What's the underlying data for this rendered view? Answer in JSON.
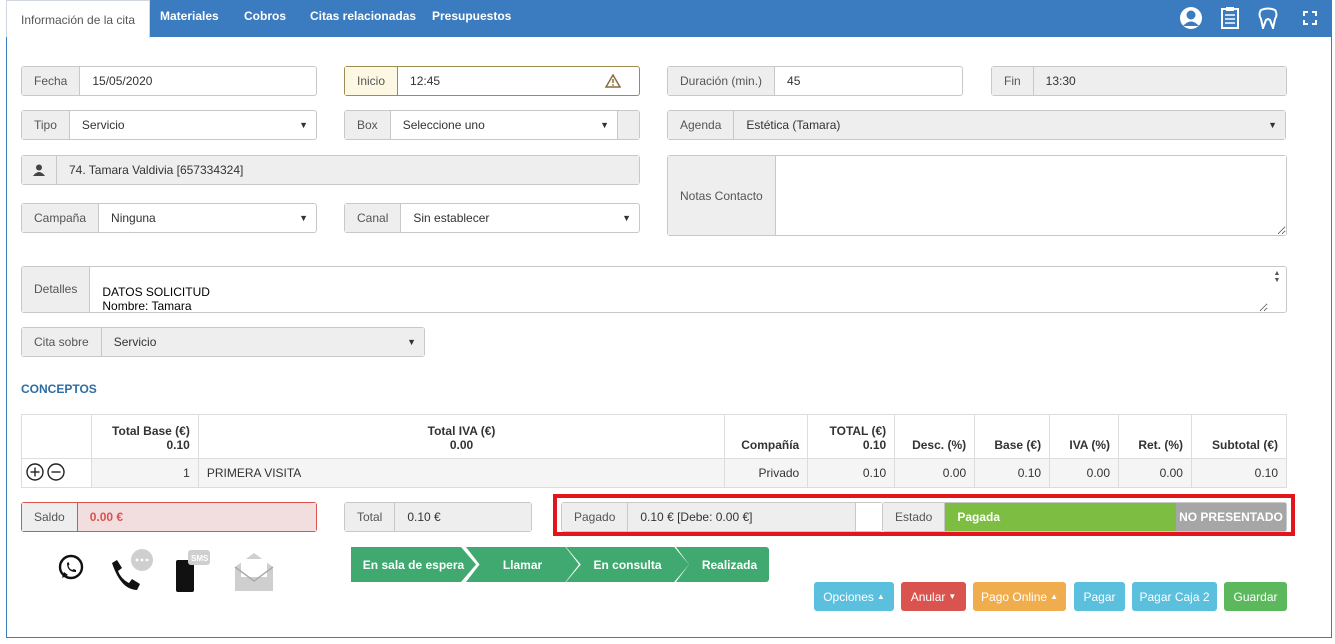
{
  "tabs": [
    {
      "label": "Información de la cita"
    },
    {
      "label": "Materiales"
    },
    {
      "label": "Cobros"
    },
    {
      "label": "Citas relacionadas"
    },
    {
      "label": "Presupuestos"
    }
  ],
  "form": {
    "fecha": {
      "label": "Fecha",
      "value": "15/05/2020"
    },
    "inicio": {
      "label": "Inicio",
      "value": "12:45"
    },
    "duracion": {
      "label": "Duración (min.)",
      "value": "45"
    },
    "fin": {
      "label": "Fin",
      "value": "13:30"
    },
    "tipo": {
      "label": "Tipo",
      "value": "Servicio"
    },
    "box": {
      "label": "Box",
      "value": "Seleccione uno"
    },
    "agenda": {
      "label": "Agenda",
      "value": "Estética (Tamara)"
    },
    "paciente": {
      "value": "74. Tamara Valdivia [657334324]"
    },
    "notas": {
      "label": "Notas Contacto",
      "value": ""
    },
    "campana": {
      "label": "Campaña",
      "value": "Ninguna"
    },
    "canal": {
      "label": "Canal",
      "value": "Sin establecer"
    },
    "detalles": {
      "label": "Detalles",
      "value": "\nDATOS SOLICITUD\nNombre: Tamara"
    },
    "cita_sobre": {
      "label": "Cita sobre",
      "value": "Servicio"
    }
  },
  "conceptos": {
    "title": "CONCEPTOS",
    "headers": {
      "total_base": "Total Base (€)",
      "total_base_val": "0.10",
      "total_iva": "Total IVA (€)",
      "total_iva_val": "0.00",
      "compania": "Compañía",
      "total": "TOTAL (€)",
      "total_val": "0.10",
      "desc": "Desc. (%)",
      "base": "Base (€)",
      "iva": "IVA (%)",
      "ret": "Ret. (%)",
      "subtotal": "Subtotal (€)"
    },
    "row": {
      "qty": "1",
      "concept": "PRIMERA VISITA",
      "compania": "Privado",
      "total": "0.10",
      "desc": "0.00",
      "base": "0.10",
      "iva": "0.00",
      "ret": "0.00",
      "subtotal": "0.10"
    }
  },
  "summary": {
    "saldo_label": "Saldo",
    "saldo_value": "0.00 €",
    "total_label": "Total",
    "total_value": "0.10 €",
    "pagado_label": "Pagado",
    "pagado_value": "0.10 € [Debe: 0.00 €]",
    "estado_label": "Estado",
    "estado_value": "Pagada",
    "no_presentado": "NO PRESENTADO"
  },
  "workflow": [
    "En sala de espera",
    "Llamar",
    "En consulta",
    "Realizada"
  ],
  "actions": {
    "opciones": "Opciones",
    "anular": "Anular",
    "pago_online": "Pago Online",
    "pagar": "Pagar",
    "pagar_caja2": "Pagar Caja 2",
    "guardar": "Guardar"
  },
  "colors": {
    "nav": "#3b7bbf",
    "green": "#3fa970",
    "estado": "#7cbd42",
    "danger": "#d9534f",
    "warning": "#f0ad4e",
    "info": "#5bc0de",
    "success": "#5cb85c",
    "highlight": "#e3141b"
  },
  "icons": [
    "user-icon",
    "document-icon",
    "tooth-icon",
    "fullscreen-icon",
    "whatsapp-icon",
    "phone-icon",
    "sms-icon",
    "email-icon"
  ]
}
